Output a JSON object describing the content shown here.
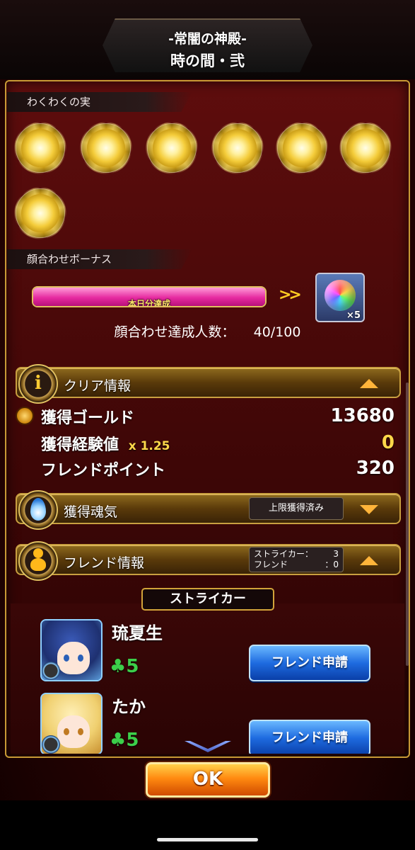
{
  "header": {
    "title_line1": "-常闇の神殿-",
    "title_line2": "時の間・弐"
  },
  "fruit_section": {
    "label": "わくわくの実",
    "fruit_count": 7
  },
  "bonus_section": {
    "label": "顔合わせボーナス",
    "progress_text": "本日分達成",
    "progress_fraction": 1.0,
    "arrows": ">>",
    "reward_count": "×5",
    "count_label": "顔合わせ達成人数：",
    "count_value": "40/100"
  },
  "clear_info": {
    "label": "クリア情報",
    "gold_label": "獲得ゴールド",
    "gold_value": "13680",
    "exp_label": "獲得経験値",
    "exp_multiplier": "x 1.25",
    "exp_value": "0",
    "friend_point_label": "フレンドポイント",
    "friend_point_value": "320"
  },
  "soul_info": {
    "label": "獲得魂気",
    "badge": "上限獲得済み"
  },
  "friend_info": {
    "label": "フレンド情報",
    "striker_label": "ストライカー：",
    "striker_count": "3",
    "friend_label": "フレンド",
    "friend_count": "：0",
    "section_title": "ストライカー",
    "friends": [
      {
        "name": "琉夏生",
        "rank": "5",
        "button": "フレンド申請"
      },
      {
        "name": "たか",
        "rank": "5",
        "button": "フレンド申請"
      }
    ]
  },
  "ok_button": "OK",
  "colors": {
    "frame_gold": "#c89a35",
    "progress_pink": "#e62aa0",
    "button_blue": "#1e6be0",
    "ok_orange": "#ff8a10"
  }
}
